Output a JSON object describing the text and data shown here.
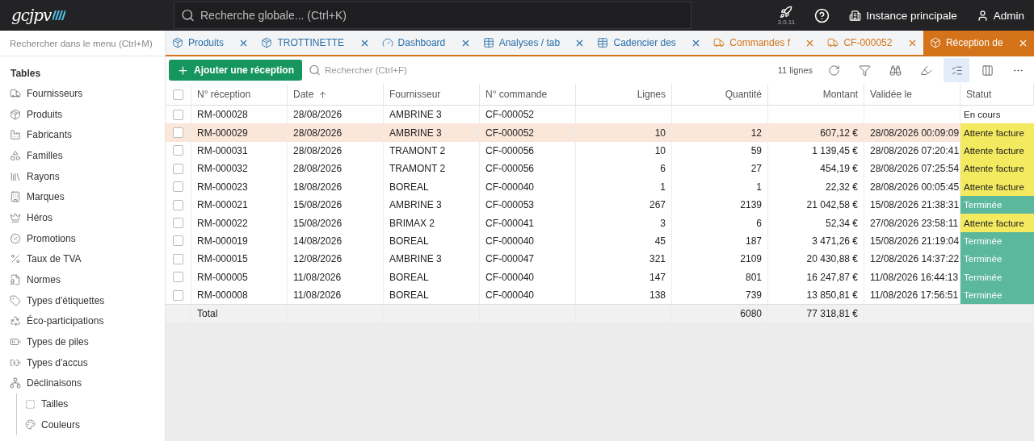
{
  "topbar": {
    "logo": "gcjpv",
    "search": {
      "placeholder": "Recherche globale... (Ctrl+K)"
    },
    "version": "3.0.11",
    "instance": "Instance principale",
    "user": "Admin"
  },
  "sidebar": {
    "search": {
      "placeholder": "Rechercher dans le menu (Ctrl+M)"
    },
    "section": "Tables",
    "items": [
      {
        "label": "Fournisseurs"
      },
      {
        "label": "Produits"
      },
      {
        "label": "Fabricants"
      },
      {
        "label": "Familles"
      },
      {
        "label": "Rayons"
      },
      {
        "label": "Marques"
      },
      {
        "label": "Héros"
      },
      {
        "label": "Promotions"
      },
      {
        "label": "Taux de TVA"
      },
      {
        "label": "Normes"
      },
      {
        "label": "Types d'étiquettes"
      },
      {
        "label": "Éco-participations"
      },
      {
        "label": "Types de piles"
      },
      {
        "label": "Types d'accus"
      },
      {
        "label": "Déclinaisons",
        "children": [
          {
            "label": "Tailles"
          },
          {
            "label": "Couleurs"
          }
        ]
      }
    ]
  },
  "tabs": [
    {
      "label": "Produits",
      "kind": "cube",
      "color": "#2a6fa8",
      "selected": false
    },
    {
      "label": "TROTTINETTE",
      "kind": "cube",
      "color": "#2a6fa8",
      "selected": false
    },
    {
      "label": "Dashboard",
      "kind": "gauge",
      "color": "#2a6fa8",
      "selected": false
    },
    {
      "label": "Analyses / tab",
      "kind": "table",
      "color": "#2a6fa8",
      "selected": false
    },
    {
      "label": "Cadencier des",
      "kind": "table",
      "color": "#2a6fa8",
      "selected": false
    },
    {
      "label": "Commandes f",
      "kind": "truck",
      "color": "#d4731a",
      "selected": false
    },
    {
      "label": "CF-000052",
      "kind": "truck",
      "color": "#d4731a",
      "selected": false
    },
    {
      "label": "Réception de",
      "kind": "box",
      "color": "#d4731a",
      "selected": true
    }
  ],
  "toolbar": {
    "add_button": "Ajouter une réception",
    "search": {
      "placeholder": "Rechercher (Ctrl+F)"
    },
    "count": "11 lignes",
    "tools": [
      {
        "kind": "refresh",
        "selected": false
      },
      {
        "kind": "filter",
        "selected": false
      },
      {
        "kind": "find",
        "selected": false
      },
      {
        "kind": "highlight",
        "selected": false
      },
      {
        "kind": "list",
        "selected": true
      },
      {
        "kind": "columns",
        "selected": false
      },
      {
        "kind": "more",
        "selected": false
      }
    ]
  },
  "table": {
    "columns": [
      {
        "label": "N° réception",
        "kind": "text",
        "sorted": false
      },
      {
        "label": "Date",
        "kind": "text",
        "sorted": true
      },
      {
        "label": "Fournisseur",
        "kind": "text",
        "sorted": false
      },
      {
        "label": "N° commande",
        "kind": "text",
        "sorted": false
      },
      {
        "label": "Lignes",
        "kind": "number",
        "sorted": false
      },
      {
        "label": "Quantité",
        "kind": "number",
        "sorted": false
      },
      {
        "label": "Montant",
        "kind": "number",
        "sorted": false
      },
      {
        "label": "Validée le",
        "kind": "text",
        "sorted": false
      },
      {
        "label": "Statut",
        "kind": "text",
        "sorted": false
      }
    ],
    "all_checked": false,
    "rows": [
      {
        "checked": false,
        "highlighted": false,
        "cells": [
          "RM-000028",
          "28/08/2026",
          "AMBRINE 3",
          "CF-000052",
          "",
          "",
          "",
          ""
        ],
        "status": {
          "label": "En cours"
        }
      },
      {
        "checked": false,
        "highlighted": true,
        "cells": [
          "RM-000029",
          "28/08/2026",
          "AMBRINE 3",
          "CF-000052",
          "10",
          "12",
          "607,12 €",
          "28/08/2026 00:09:09"
        ],
        "status": {
          "label": "Attente facture",
          "color": "#f3ea5f"
        }
      },
      {
        "checked": false,
        "highlighted": false,
        "cells": [
          "RM-000031",
          "28/08/2026",
          "TRAMONT 2",
          "CF-000056",
          "10",
          "59",
          "1 139,45 €",
          "28/08/2026 07:20:41"
        ],
        "status": {
          "label": "Attente facture",
          "color": "#f3ea5f"
        }
      },
      {
        "checked": false,
        "highlighted": false,
        "cells": [
          "RM-000032",
          "28/08/2026",
          "TRAMONT 2",
          "CF-000056",
          "6",
          "27",
          "454,19 €",
          "28/08/2026 07:25:54"
        ],
        "status": {
          "label": "Attente facture",
          "color": "#f3ea5f"
        }
      },
      {
        "checked": false,
        "highlighted": false,
        "cells": [
          "RM-000023",
          "18/08/2026",
          "BOREAL",
          "CF-000040",
          "1",
          "1",
          "22,32 €",
          "28/08/2026 00:05:45"
        ],
        "status": {
          "label": "Attente facture",
          "color": "#f3ea5f"
        }
      },
      {
        "checked": false,
        "highlighted": false,
        "cells": [
          "RM-000021",
          "15/08/2026",
          "AMBRINE 3",
          "CF-000053",
          "267",
          "2139",
          "21 042,58 €",
          "15/08/2026 21:38:31"
        ],
        "status": {
          "label": "Terminée",
          "color": "#5bb89c"
        }
      },
      {
        "checked": false,
        "highlighted": false,
        "cells": [
          "RM-000022",
          "15/08/2026",
          "BRIMAX 2",
          "CF-000041",
          "3",
          "6",
          "52,34 €",
          "27/08/2026 23:58:11"
        ],
        "status": {
          "label": "Attente facture",
          "color": "#f3ea5f"
        }
      },
      {
        "checked": false,
        "highlighted": false,
        "cells": [
          "RM-000019",
          "14/08/2026",
          "BOREAL",
          "CF-000040",
          "45",
          "187",
          "3 471,26 €",
          "15/08/2026 21:19:04"
        ],
        "status": {
          "label": "Terminée",
          "color": "#5bb89c"
        }
      },
      {
        "checked": false,
        "highlighted": false,
        "cells": [
          "RM-000015",
          "12/08/2026",
          "AMBRINE 3",
          "CF-000047",
          "321",
          "2109",
          "20 430,88 €",
          "12/08/2026 14:37:22"
        ],
        "status": {
          "label": "Terminée",
          "color": "#5bb89c"
        }
      },
      {
        "checked": false,
        "highlighted": false,
        "cells": [
          "RM-000005",
          "11/08/2026",
          "BOREAL",
          "CF-000040",
          "147",
          "801",
          "16 247,87 €",
          "11/08/2026 16:44:13"
        ],
        "status": {
          "label": "Terminée",
          "color": "#5bb89c"
        }
      },
      {
        "checked": false,
        "highlighted": false,
        "cells": [
          "RM-000008",
          "11/08/2026",
          "BOREAL",
          "CF-000040",
          "138",
          "739",
          "13 850,81 €",
          "11/08/2026 17:56:51"
        ],
        "status": {
          "label": "Terminée",
          "color": "#5bb89c"
        }
      }
    ],
    "total": {
      "label": "Total",
      "cells": [
        "",
        "",
        "",
        "",
        "",
        "6080",
        "77 318,81 €",
        "",
        ""
      ]
    }
  }
}
